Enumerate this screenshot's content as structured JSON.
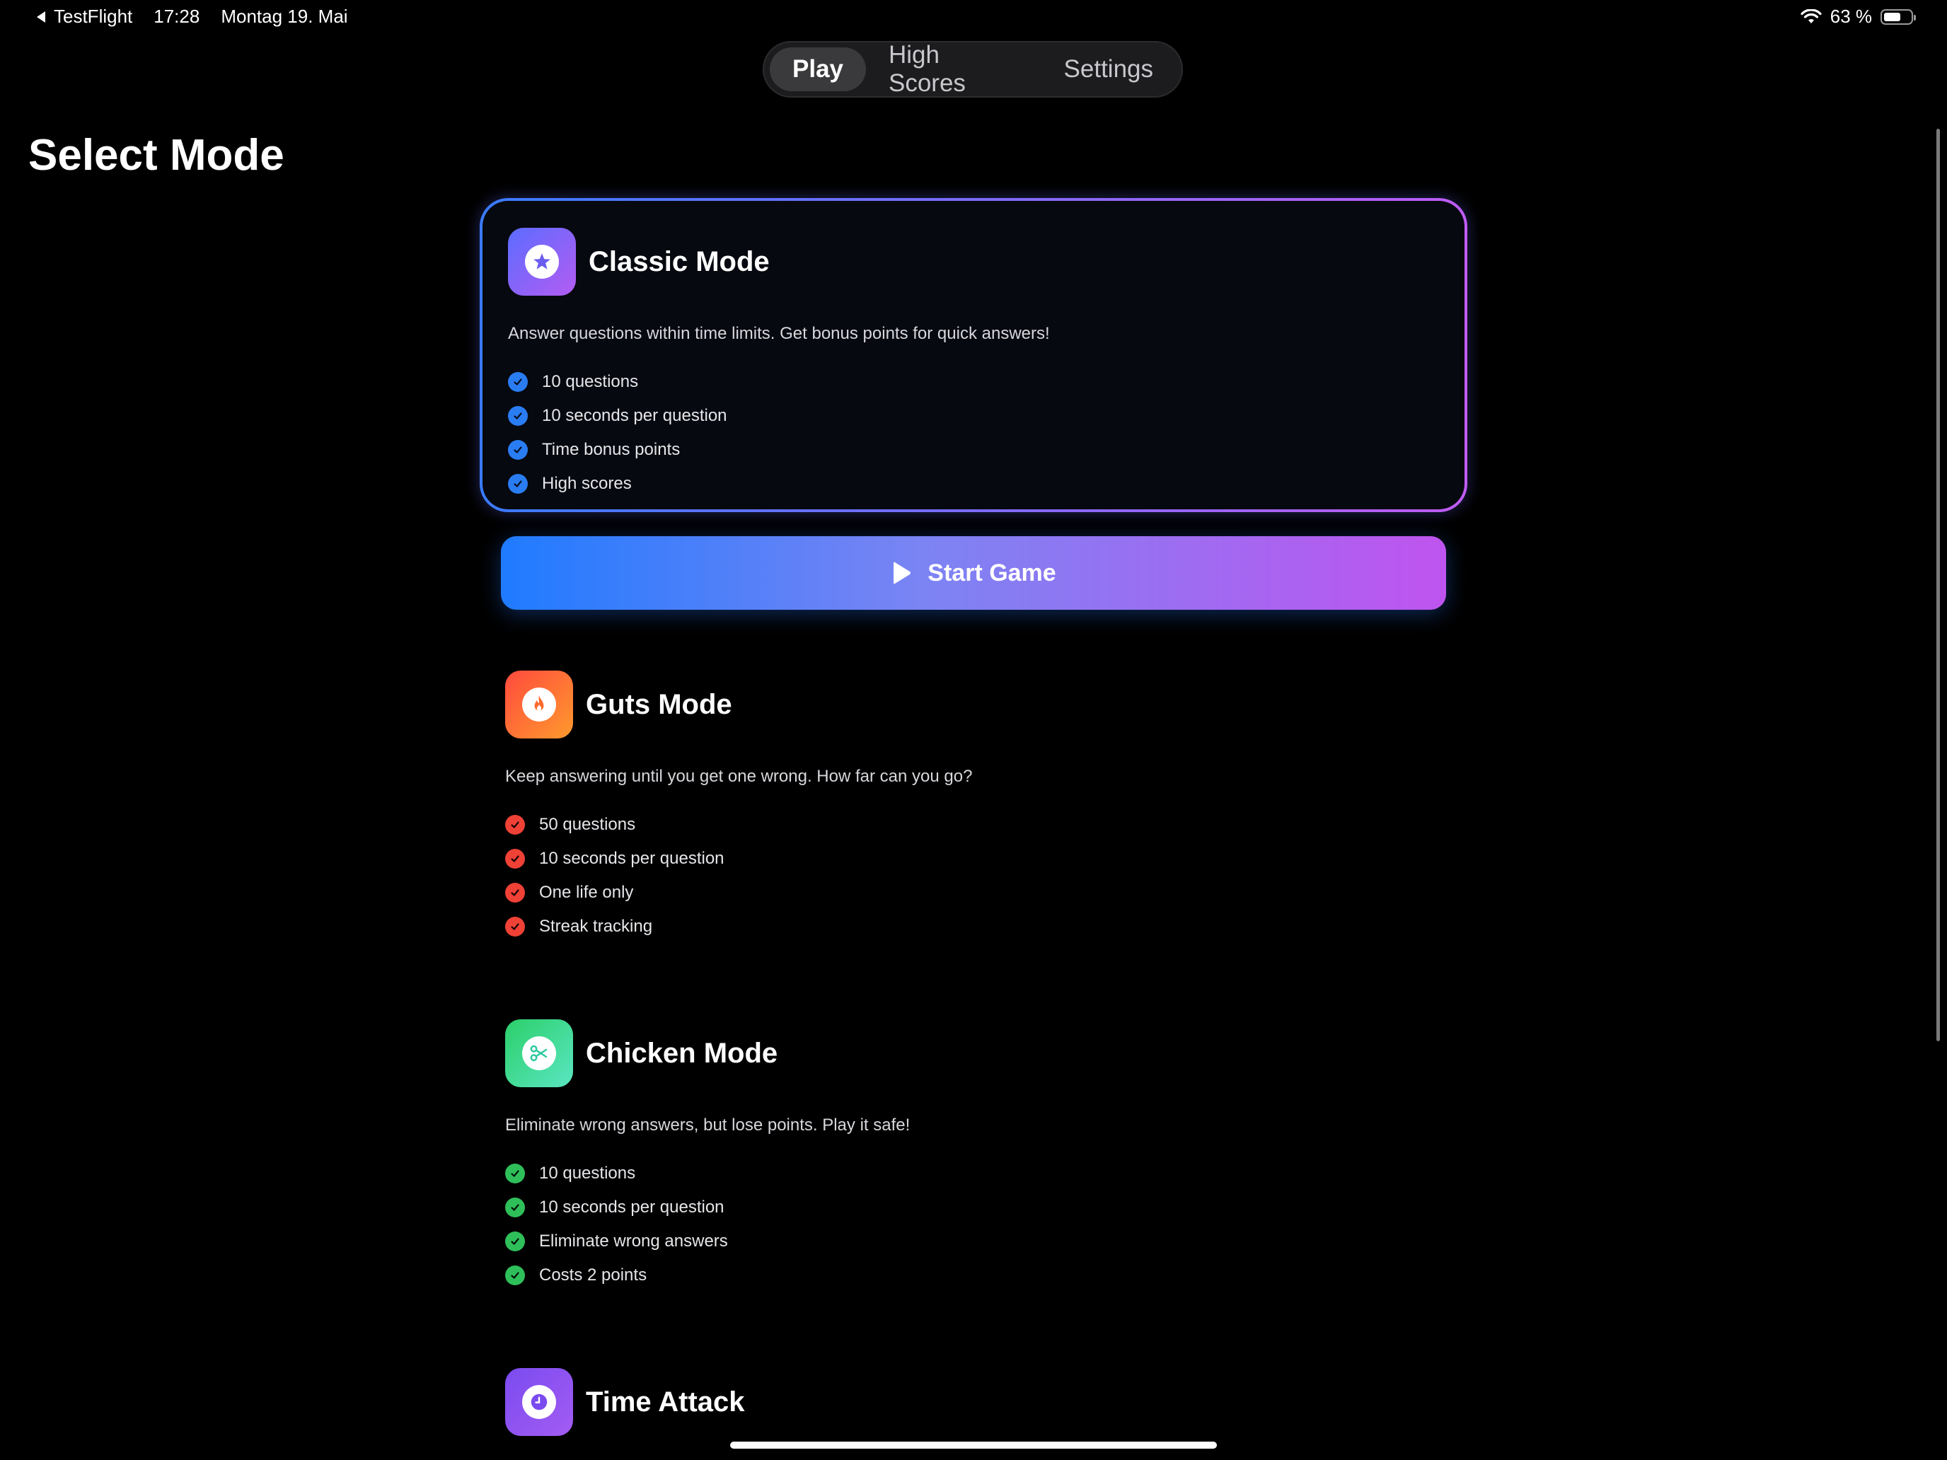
{
  "status_bar": {
    "back_label": "TestFlight",
    "time": "17:28",
    "date": "Montag 19. Mai",
    "battery_text": "63 %",
    "battery_level": 0.63
  },
  "tabs": [
    {
      "label": "Play",
      "active": true
    },
    {
      "label": "High Scores",
      "active": false
    },
    {
      "label": "Settings",
      "active": false
    }
  ],
  "page_title": "Select Mode",
  "modes": [
    {
      "title": "Classic Mode",
      "icon": "star-icon",
      "description": "Answer questions within time limits. Get bonus points for quick answers!",
      "features": [
        "10 questions",
        "10 seconds per question",
        "Time bonus points",
        "High scores"
      ],
      "accent": "#3b82f6"
    },
    {
      "title": "Guts Mode",
      "icon": "flame-icon",
      "description": "Keep answering until you get one wrong. How far can you go?",
      "features": [
        "50 questions",
        "10 seconds per question",
        "One life only",
        "Streak tracking"
      ],
      "accent": "#ef4444"
    },
    {
      "title": "Chicken Mode",
      "icon": "scissors-icon",
      "description": "Eliminate wrong answers, but lose points. Play it safe!",
      "features": [
        "10 questions",
        "10 seconds per question",
        "Eliminate wrong answers",
        "Costs 2 points"
      ],
      "accent": "#22c55e"
    },
    {
      "title": "Time Attack",
      "icon": "clock-icon",
      "accent": "#8b5cf6"
    }
  ],
  "start_button": {
    "label": "Start Game"
  },
  "colors": {
    "background": "#000000",
    "selected_border_start": "#3a7bff",
    "selected_border_end": "#c05cf5"
  }
}
